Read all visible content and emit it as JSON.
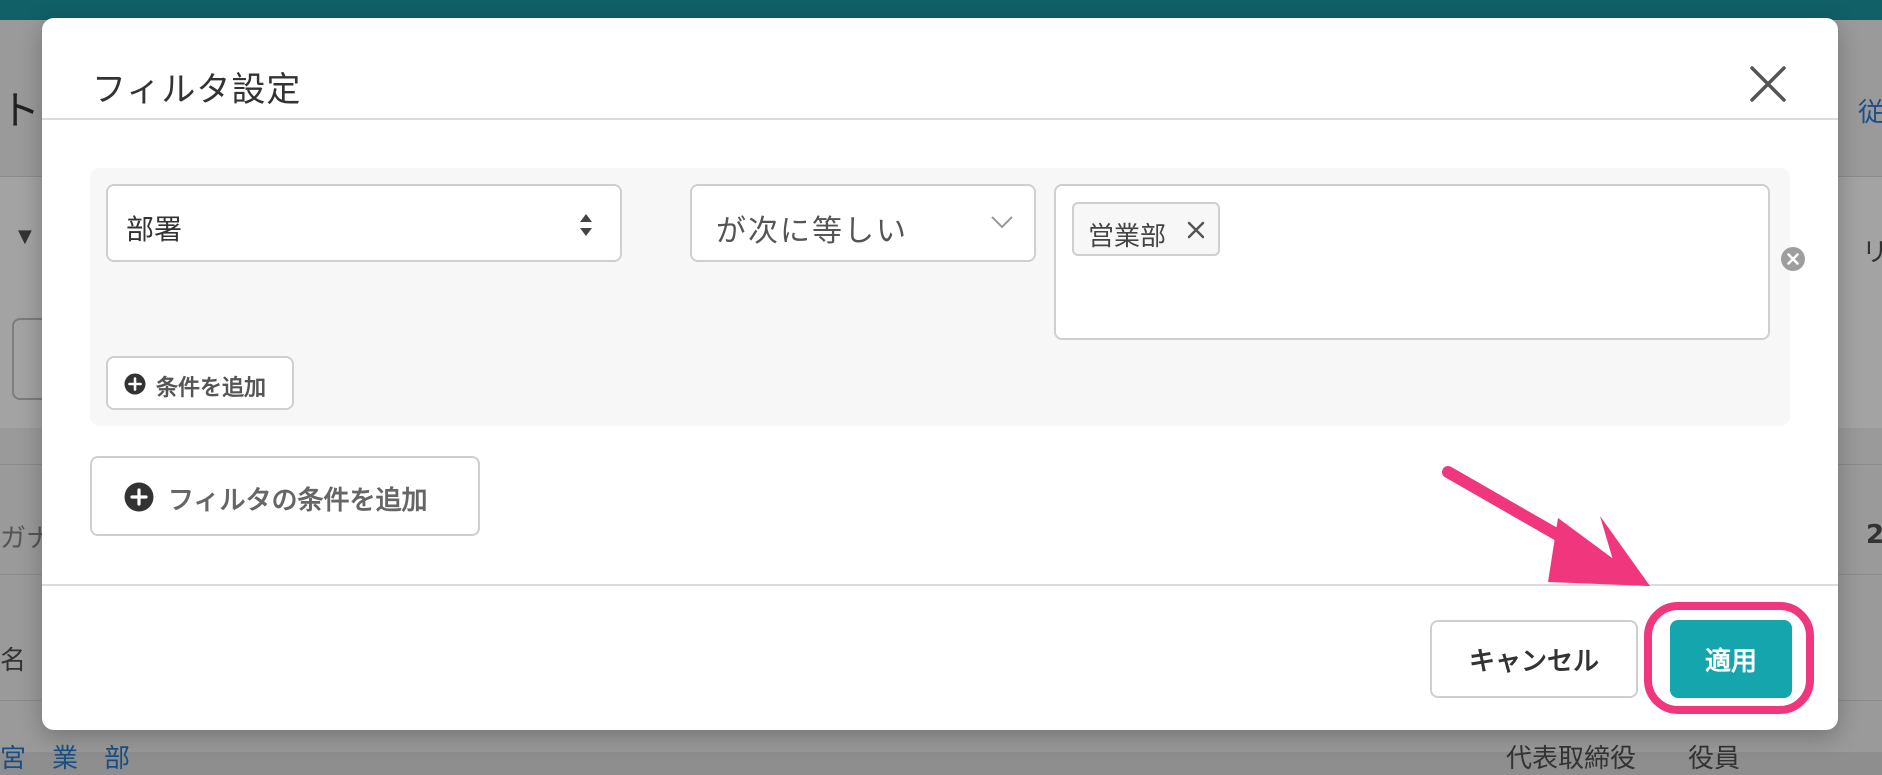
{
  "background": {
    "heading_fragment": "ト",
    "right_link_fragment": "従",
    "right_fragment": "リ",
    "left_col_fragment": "ガナ",
    "right_num_fragment": "2",
    "left_row_fragment": "名",
    "bottom_left_fragment": "宮　業　部",
    "bottom_right_fragment": "代表取締役　　役員"
  },
  "modal": {
    "title": "フィルタ設定",
    "close_icon": "close-icon",
    "condition": {
      "field_value": "部署",
      "operator_value": "が次に等しい",
      "tags": [
        "営業部"
      ]
    },
    "add_condition_label": "条件を追加",
    "add_filter_label": "フィルタの条件を追加",
    "footer": {
      "cancel_label": "キャンセル",
      "apply_label": "適用"
    }
  },
  "colors": {
    "accent": "#15a5ad",
    "annotation": "#f0367d",
    "topbar": "#116067"
  }
}
